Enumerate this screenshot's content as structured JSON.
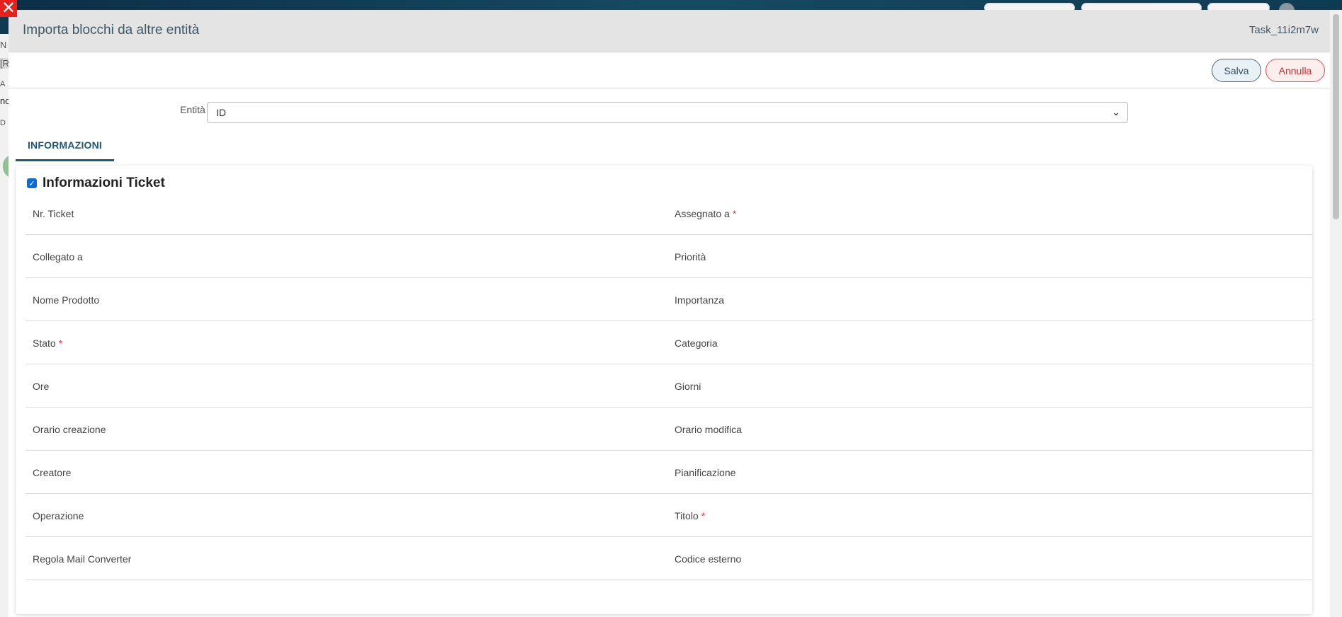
{
  "modal": {
    "title": "Importa blocchi da altre entità",
    "record_id": "Task_11i2m7w",
    "save_label": "Salva",
    "cancel_label": "Annulla"
  },
  "entity": {
    "label": "Entità",
    "selected": "ID"
  },
  "tabs": [
    {
      "label": "INFORMAZIONI",
      "active": true
    }
  ],
  "block": {
    "title": "Informazioni Ticket",
    "checked": true,
    "rows": [
      {
        "left": "Nr. Ticket",
        "left_required": false,
        "right": "Assegnato a",
        "right_required": true
      },
      {
        "left": "Collegato a",
        "left_required": false,
        "right": "Priorità",
        "right_required": false
      },
      {
        "left": "Nome Prodotto",
        "left_required": false,
        "right": "Importanza",
        "right_required": false
      },
      {
        "left": "Stato",
        "left_required": true,
        "right": "Categoria",
        "right_required": false
      },
      {
        "left": "Ore",
        "left_required": false,
        "right": "Giorni",
        "right_required": false
      },
      {
        "left": "Orario creazione",
        "left_required": false,
        "right": "Orario modifica",
        "right_required": false
      },
      {
        "left": "Creatore",
        "left_required": false,
        "right": "Pianificazione",
        "right_required": false
      },
      {
        "left": "Operazione",
        "left_required": false,
        "right": "Titolo",
        "right_required": true
      },
      {
        "left": "Regola Mail Converter",
        "left_required": false,
        "right": "Codice esterno",
        "right_required": false
      }
    ]
  },
  "background_fragments": [
    "N",
    "[R",
    "A",
    "no",
    "D"
  ],
  "required_marker": "*",
  "icons": {
    "close": "close-icon",
    "chevron": "chevron-down-icon",
    "checkbox": "checkmark-icon"
  },
  "colors": {
    "header_bg": "#e4e4e4",
    "accent": "#1d5877",
    "save_border": "#4a6878",
    "cancel_border": "#e94b4b",
    "required": "#e23b3b"
  }
}
